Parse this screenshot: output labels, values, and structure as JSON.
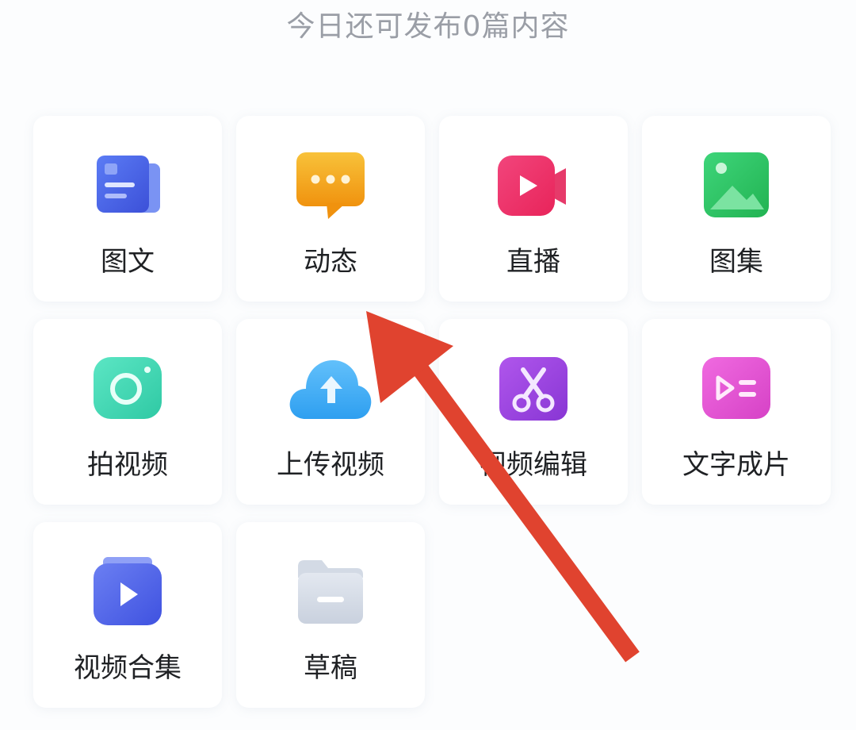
{
  "header": {
    "quota_text": "今日还可发布0篇内容"
  },
  "publish_options": [
    {
      "label": "图文",
      "icon": "article-icon",
      "color": "#4a66e6"
    },
    {
      "label": "动态",
      "icon": "chat-bubble-icon",
      "color": "#f2ad1f"
    },
    {
      "label": "直播",
      "icon": "live-camera-icon",
      "color": "#ef2f6a"
    },
    {
      "label": "图集",
      "icon": "image-gallery-icon",
      "color": "#2ec463"
    },
    {
      "label": "拍视频",
      "icon": "camera-icon",
      "color": "#3ed7b4"
    },
    {
      "label": "上传视频",
      "icon": "cloud-upload-icon",
      "color": "#3ea7f2"
    },
    {
      "label": "视频编辑",
      "icon": "scissors-icon",
      "color": "#9a45de"
    },
    {
      "label": "文字成片",
      "icon": "text-to-video-icon",
      "color": "#e85ad2"
    },
    {
      "label": "视频合集",
      "icon": "video-collection-icon",
      "color": "#4f64e8"
    },
    {
      "label": "草稿",
      "icon": "drafts-folder-icon",
      "color": "#cfd6e2"
    }
  ],
  "annotation": {
    "arrow_color": "#e0432f"
  }
}
